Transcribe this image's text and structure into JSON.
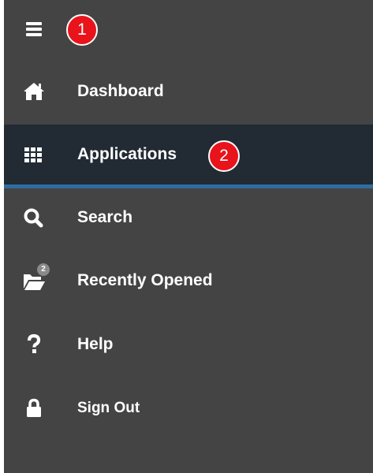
{
  "menu": {
    "callouts": [
      "1",
      "2"
    ],
    "items": [
      {
        "label": "Dashboard",
        "icon": "home-icon"
      },
      {
        "label": "Applications",
        "icon": "grid-icon",
        "active": true
      },
      {
        "label": "Search",
        "icon": "search-icon"
      },
      {
        "label": "Recently Opened",
        "icon": "folder-open-icon",
        "badge": "2"
      },
      {
        "label": "Help",
        "icon": "question-icon"
      },
      {
        "label": "Sign Out",
        "icon": "lock-icon"
      }
    ]
  },
  "colors": {
    "menu_background": "#444444",
    "active_background": "#222a33",
    "active_underline": "#2f6da0",
    "callout_red": "#e8131b",
    "badge_gray": "#8a8a8a"
  }
}
